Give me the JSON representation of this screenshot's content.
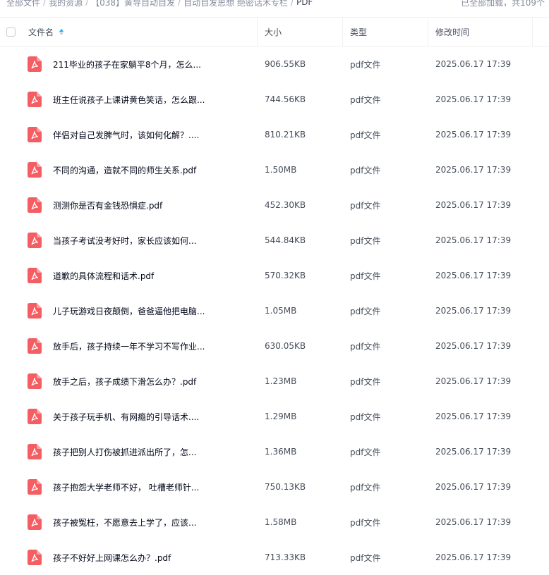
{
  "breadcrumb": {
    "items": [
      "全部文件",
      "我的资源",
      "【038】黄导自动自发",
      "自动自发思想 绝密话术专栏",
      "PDF"
    ],
    "separator": "/"
  },
  "load_status": "已全部加载，共109个",
  "columns": {
    "name": "文件名",
    "size": "大小",
    "type": "类型",
    "modified": "修改时间"
  },
  "sort": {
    "column": "name",
    "direction": "ascending"
  },
  "colors": {
    "accent": "#06a7ff",
    "pdf_icon": "#f45e63"
  },
  "files": [
    {
      "name": "211毕业的孩子在家躺平8个月，怎么...",
      "size": "906.55KB",
      "type": "pdf文件",
      "modified": "2025.06.17 17:39"
    },
    {
      "name": "班主任说孩子上课讲黄色笑话，怎么跟...",
      "size": "744.56KB",
      "type": "pdf文件",
      "modified": "2025.06.17 17:39"
    },
    {
      "name": "伴侣对自己发脾气时，该如何化解？....",
      "size": "810.21KB",
      "type": "pdf文件",
      "modified": "2025.06.17 17:39"
    },
    {
      "name": "不同的沟通，造就不同的师生关系.pdf",
      "size": "1.50MB",
      "type": "pdf文件",
      "modified": "2025.06.17 17:39"
    },
    {
      "name": "测测你是否有金钱恐惧症.pdf",
      "size": "452.30KB",
      "type": "pdf文件",
      "modified": "2025.06.17 17:39"
    },
    {
      "name": "当孩子考试没考好时，家长应该如何...",
      "size": "544.84KB",
      "type": "pdf文件",
      "modified": "2025.06.17 17:39"
    },
    {
      "name": "道歉的具体流程和话术.pdf",
      "size": "570.32KB",
      "type": "pdf文件",
      "modified": "2025.06.17 17:39"
    },
    {
      "name": "儿子玩游戏日夜颠倒，爸爸逼他把电脑...",
      "size": "1.05MB",
      "type": "pdf文件",
      "modified": "2025.06.17 17:39"
    },
    {
      "name": "放手后，孩子持续一年不学习不写作业...",
      "size": "630.05KB",
      "type": "pdf文件",
      "modified": "2025.06.17 17:39"
    },
    {
      "name": "放手之后，孩子成绩下滑怎么办？.pdf",
      "size": "1.23MB",
      "type": "pdf文件",
      "modified": "2025.06.17 17:39"
    },
    {
      "name": "关于孩子玩手机、有网瘾的引导话术....",
      "size": "1.29MB",
      "type": "pdf文件",
      "modified": "2025.06.17 17:39"
    },
    {
      "name": "孩子把别人打伤被抓进派出所了，怎...",
      "size": "1.36MB",
      "type": "pdf文件",
      "modified": "2025.06.17 17:39"
    },
    {
      "name": "孩子抱怨大学老师不好， 吐槽老师针...",
      "size": "750.13KB",
      "type": "pdf文件",
      "modified": "2025.06.17 17:39"
    },
    {
      "name": "孩子被冤枉，不愿意去上学了，应该...",
      "size": "1.58MB",
      "type": "pdf文件",
      "modified": "2025.06.17 17:39"
    },
    {
      "name": "孩子不好好上网课怎么办？.pdf",
      "size": "713.33KB",
      "type": "pdf文件",
      "modified": "2025.06.17 17:39"
    }
  ]
}
